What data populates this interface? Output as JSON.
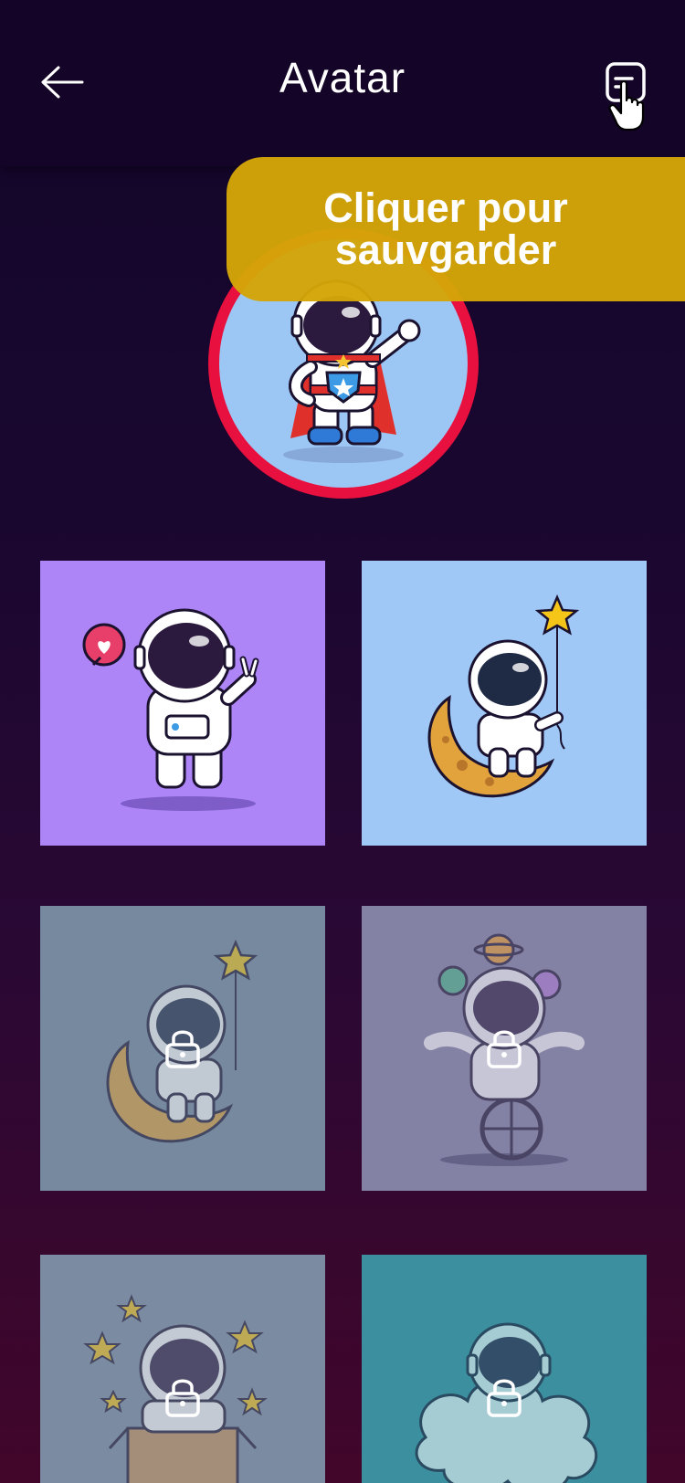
{
  "header": {
    "title": "Avatar",
    "back_icon": "arrow-left-icon",
    "save_icon": "save-icon"
  },
  "tooltip": {
    "line1": "Cliquer pour",
    "line2": "sauvgarder"
  },
  "selected_avatar": {
    "name": "superhero-astronaut",
    "ring_color": "#e8103e",
    "bg_color": "#9cc7f5"
  },
  "avatars": [
    {
      "name": "astronaut-peace-heart",
      "bg": "#ad85f6",
      "locked": false
    },
    {
      "name": "astronaut-moon-star",
      "bg": "#9fc8f7",
      "locked": false
    },
    {
      "name": "astronaut-moon-star",
      "bg": "#76899f",
      "locked": true
    },
    {
      "name": "astronaut-unicycle-planets",
      "bg": "#8482a4",
      "locked": true
    },
    {
      "name": "astronaut-space-box",
      "bg": "#7b8ba1",
      "locked": true
    },
    {
      "name": "astronaut-cloud",
      "bg": "#3b8f9f",
      "locked": true
    }
  ],
  "colors": {
    "header_bg": "#140427",
    "tooltip_bg": "#d4a508",
    "accent_red": "#e8103e"
  }
}
